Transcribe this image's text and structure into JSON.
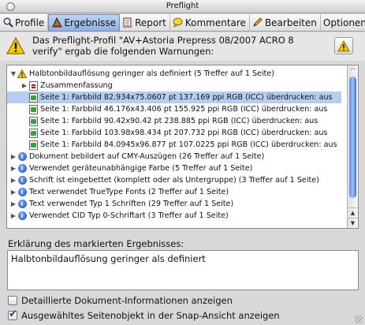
{
  "window": {
    "title": "Preflight"
  },
  "tabs": [
    {
      "label": "Profile",
      "icon": "magnifier-icon"
    },
    {
      "label": "Ergebnisse",
      "icon": "results-icon",
      "active": true
    },
    {
      "label": "Report",
      "icon": "report-icon"
    },
    {
      "label": "Kommentare",
      "icon": "speech-bubble-icon"
    },
    {
      "label": "Bearbeiten",
      "icon": "pencil-icon"
    },
    {
      "label": "Optionen"
    }
  ],
  "warning": {
    "message": "Das Preflight-Profil \"AV+Astoria Prepress 08/2007 ACRO 8 verify\" ergab die folgenden Warnungen:"
  },
  "tree": {
    "group_title": "Halbtonbildauflösung geringer als definiert (5 Treffer auf 1 Seite)",
    "summary": "Zusammenfassung",
    "results": [
      "Seite 1: Farbbild 82.934x75.0607 pt 137.169 ppi RGB (ICC) überdrucken: aus",
      "Seite 1: Farbbild 46.176x43.406 pt 155.925 ppi RGB (ICC) überdrucken: aus",
      "Seite 1: Farbbild 90.42x90.42 pt 238.885 ppi RGB (ICC) überdrucken: aus",
      "Seite 1: Farbbild 103.98x98.434 pt 207.732 ppi RGB (ICC) überdrucken: aus",
      "Seite 1: Farbbild 84.0945x96.877 pt 107.0225 ppi RGB (ICC) überdrucken: aus"
    ],
    "info_items": [
      "Dokument bebildert auf CMY-Auszügen (26 Treffer auf 1 Seite)",
      "Verwendet geräteunabhängige Farbe (5 Treffer auf 1 Seite)",
      "Schrift ist eingebettet (komplett oder als Untergruppe) (3 Treffer auf 1 Seite)",
      "Text verwendet TrueType Fonts (2 Treffer auf 1 Seite)",
      "Text verwendet Typ 1 Schriften (29 Treffer auf 1 Seite)",
      "Verwendet CID Typ 0-Schriftart (3 Treffer auf 1 Seite)"
    ]
  },
  "explanation": {
    "label": "Erklärung des markierten Ergebnisses:",
    "text": "Halbtonbildauflösung geringer als definiert"
  },
  "options": {
    "detail_info": {
      "label": "Detaillierte Dokument-Informationen anzeigen",
      "checked": false
    },
    "snap_view": {
      "label": "Ausgewähltes Seitenobjekt in der Snap-Ansicht anzeigen",
      "checked": true
    }
  },
  "colors": {
    "selection": "#b6cdf2",
    "accent": "#1a4fc0",
    "warning": "#f0c000"
  }
}
